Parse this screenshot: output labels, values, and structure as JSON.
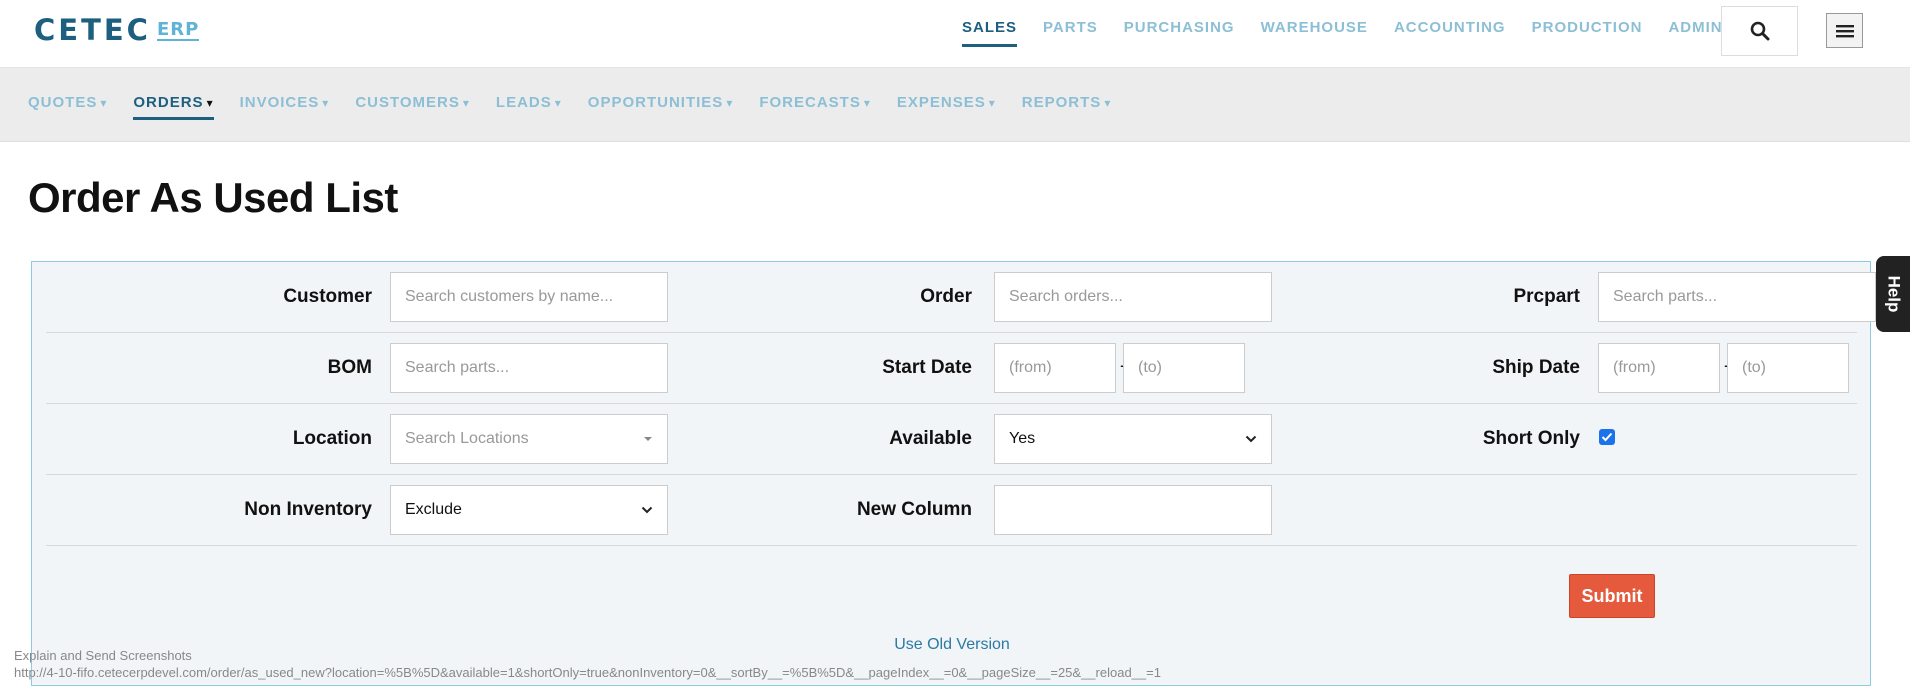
{
  "logo": {
    "main": "CETEC",
    "suffix": "ERP"
  },
  "mainnav": [
    {
      "label": "SALES",
      "active": true
    },
    {
      "label": "PARTS"
    },
    {
      "label": "PURCHASING"
    },
    {
      "label": "WAREHOUSE"
    },
    {
      "label": "ACCOUNTING"
    },
    {
      "label": "PRODUCTION"
    },
    {
      "label": "ADMIN"
    }
  ],
  "subnav": [
    {
      "label": "QUOTES",
      "caret": "▾"
    },
    {
      "label": "ORDERS",
      "caret": "▾",
      "active": true
    },
    {
      "label": "INVOICES",
      "caret": "▾"
    },
    {
      "label": "CUSTOMERS",
      "caret": "▾"
    },
    {
      "label": "LEADS",
      "caret": "▾"
    },
    {
      "label": "OPPORTUNITIES",
      "caret": "▾"
    },
    {
      "label": "FORECASTS",
      "caret": "▾"
    },
    {
      "label": "EXPENSES",
      "caret": "▾"
    },
    {
      "label": "REPORTS",
      "caret": "▾"
    }
  ],
  "page": {
    "title": "Order As Used List"
  },
  "filters": {
    "customer": {
      "label": "Customer",
      "placeholder": "Search customers by name..."
    },
    "order": {
      "label": "Order",
      "placeholder": "Search orders..."
    },
    "prcpart": {
      "label": "Prcpart",
      "placeholder": "Search parts..."
    },
    "bom": {
      "label": "BOM",
      "placeholder": "Search parts..."
    },
    "start_date": {
      "label": "Start Date",
      "from": "(from)",
      "to": "(to)",
      "sep": "-"
    },
    "ship_date": {
      "label": "Ship Date",
      "from": "(from)",
      "to": "(to)",
      "sep": "-"
    },
    "location": {
      "label": "Location",
      "placeholder": "Search Locations"
    },
    "available": {
      "label": "Available",
      "value": "Yes"
    },
    "short_only": {
      "label": "Short Only",
      "checked": true
    },
    "non_inventory": {
      "label": "Non Inventory",
      "value": "Exclude"
    },
    "new_column": {
      "label": "New Column",
      "value": ""
    }
  },
  "actions": {
    "submit": "Submit",
    "old_version": "Use Old Version"
  },
  "help": {
    "label": "Help"
  },
  "overlay": {
    "explain": "Explain and Send Screenshots",
    "url": "http://4-10-fifo.cetecerpdevel.com/order/as_used_new?location=%5B%5D&available=1&shortOnly=true&nonInventory=0&__sortBy__=%5B%5D&__pageIndex__=0&__pageSize__=25&__reload__=1"
  },
  "icons": {
    "search": "search-icon",
    "menu": "hamburger-menu-icon",
    "check": "checkmark-icon"
  },
  "colors": {
    "brand": "#1d5f7e",
    "nav_inactive": "#8cbfd6",
    "submit": "#e55a3c",
    "panel_border": "#8ecbe3"
  }
}
